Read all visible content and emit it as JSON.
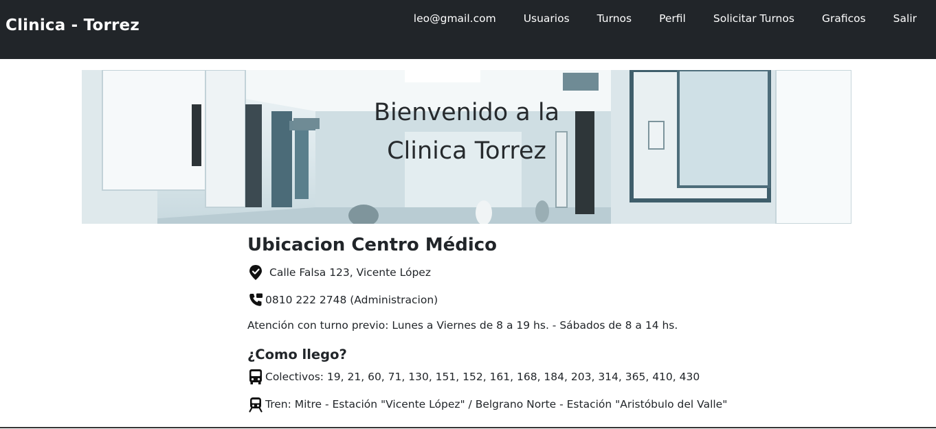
{
  "navbar": {
    "brand": "Clinica - Torrez",
    "links": [
      "leo@gmail.com",
      "Usuarios",
      "Turnos",
      "Perfil",
      "Solicitar Turnos",
      "Graficos",
      "Salir"
    ]
  },
  "hero": {
    "title_line1": "Bienvenido a la",
    "title_line2": "Clinica Torrez"
  },
  "location": {
    "heading": "Ubicacion Centro Médico",
    "address": "Calle Falsa 123, Vicente López",
    "phone": "0810 222 2748 (Administracion)",
    "hours": "Atención con turno previo: Lunes a Viernes de 8 a 19 hs. - Sábados de 8 a 14 hs."
  },
  "how_to_get": {
    "heading": "¿Como llego?",
    "bus": "Colectivos: 19, 21, 60, 71, 130, 151, 152, 161, 168, 184, 203, 314, 365, 410, 430",
    "train": "Tren: Mitre - Estación \"Vicente López\" / Belgrano Norte - Estación \"Aristóbulo del Valle\""
  },
  "icons": {
    "address": "map-pin-icon",
    "phone": "phone-icon",
    "bus": "bus-icon",
    "train": "train-icon"
  },
  "colors": {
    "navbar_bg": "#212529",
    "text": "#212529"
  }
}
